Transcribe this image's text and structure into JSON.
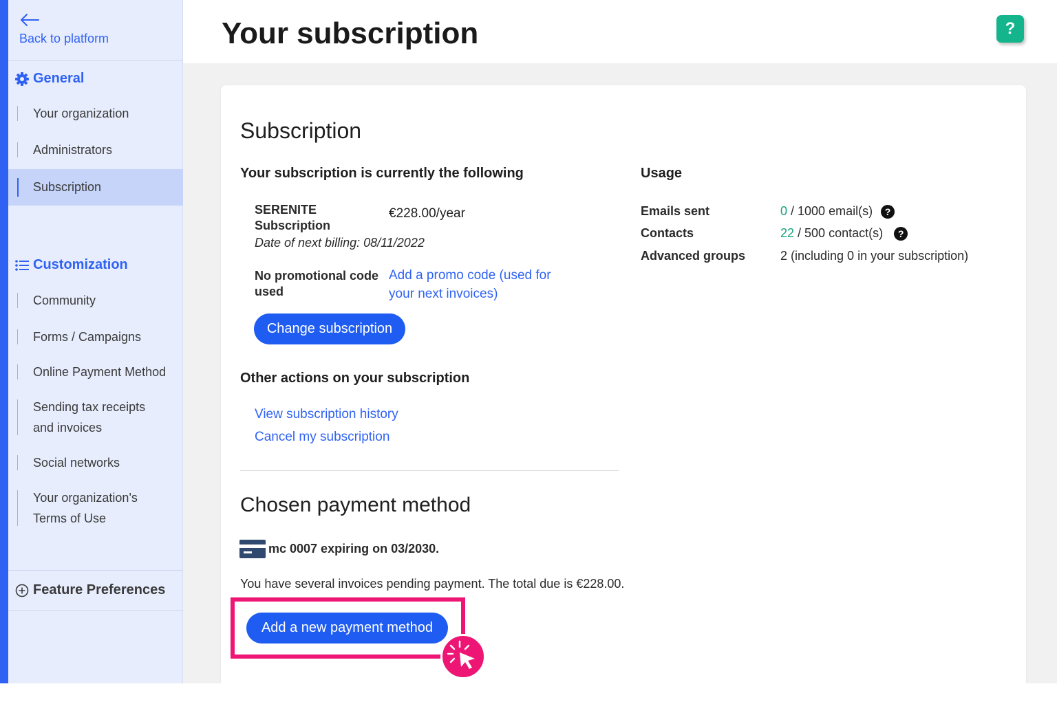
{
  "sidebar": {
    "back_label": "Back to platform",
    "sections": {
      "general": "General",
      "customization": "Customization",
      "feature_prefs": "Feature Preferences"
    },
    "general_items": [
      "Your organization",
      "Administrators",
      "Subscription"
    ],
    "customization_items": {
      "community": "Community",
      "forms": "Forms / Campaigns",
      "online_payment": "Online Payment Method",
      "tax_line1": "Sending tax receipts",
      "tax_line2": "and invoices",
      "social": "Social networks",
      "terms_line1": "Your organization's",
      "terms_line2": "Terms of Use"
    },
    "active_item": "Subscription"
  },
  "header": {
    "title": "Your subscription",
    "help_label": "?"
  },
  "subscription": {
    "heading": "Subscription",
    "current_heading": "Your subscription is currently the following",
    "plan_line1": "SERENITE",
    "plan_line2": "Subscription",
    "price": "€228.00/year",
    "next_billing": "Date of next billing: 08/11/2022",
    "promo_line1": "No promotional code",
    "promo_line2": "used",
    "promo_link_line1": "Add a promo code (used for",
    "promo_link_line2": "your next invoices)",
    "change_button": "Change subscription",
    "other_heading": "Other actions on your subscription",
    "history_link": "View subscription history",
    "cancel_link": "Cancel my subscription"
  },
  "usage": {
    "heading": "Usage",
    "emails_label": "Emails sent",
    "emails_used": "0",
    "emails_rest": " / 1000 email(s)",
    "contacts_label": "Contacts",
    "contacts_used": "22",
    "contacts_rest": " / 500 contact(s)",
    "groups_label": "Advanced groups",
    "groups_value": "2 (including 0 in your subscription)",
    "help_icon": "?"
  },
  "payment": {
    "heading": "Chosen payment method",
    "card_text": "mc 0007 expiring on 03/2030.",
    "pending_text": "You have several invoices pending payment. The total due is €228.00.",
    "add_button": "Add a new payment method"
  },
  "icons": {
    "back": "arrow-left-icon",
    "general": "gear-icon",
    "customization": "list-icon",
    "feature_prefs": "plus-circle-icon",
    "card": "credit-card-icon",
    "click": "cursor-click-icon"
  },
  "colors": {
    "accent": "#2f62f3",
    "button": "#1f5cf1",
    "sidebar_bg": "#e7edfd",
    "active_bg": "#c5d4f8",
    "usage_green": "#14a37f",
    "help_green": "#14b58c",
    "highlight": "#ee1675"
  }
}
